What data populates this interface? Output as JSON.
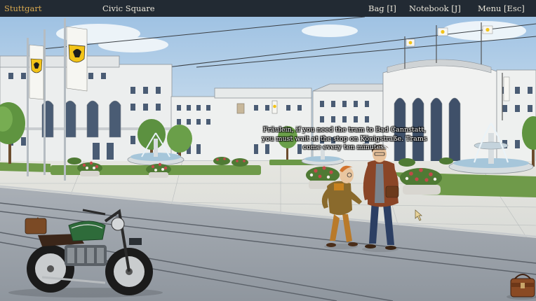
{
  "hud": {
    "city": "Stuttgart",
    "location": "Civic Square",
    "bag": "Bag [I]",
    "notebook": "Notebook [J]",
    "menu": "Menu [Esc]"
  },
  "dialogue": {
    "text": "Fräulein, if you need the tram to Bad Cannstatt, you must wait at the stop on Königstraße. Trams come every ten minutes."
  },
  "colors": {
    "hud_bar": "#222a33",
    "city_label": "#d7a84f",
    "sky": "#b9d3ea",
    "building": "#eef0ef",
    "window": "#4a5c74",
    "flag_yellow": "#f2c318"
  }
}
